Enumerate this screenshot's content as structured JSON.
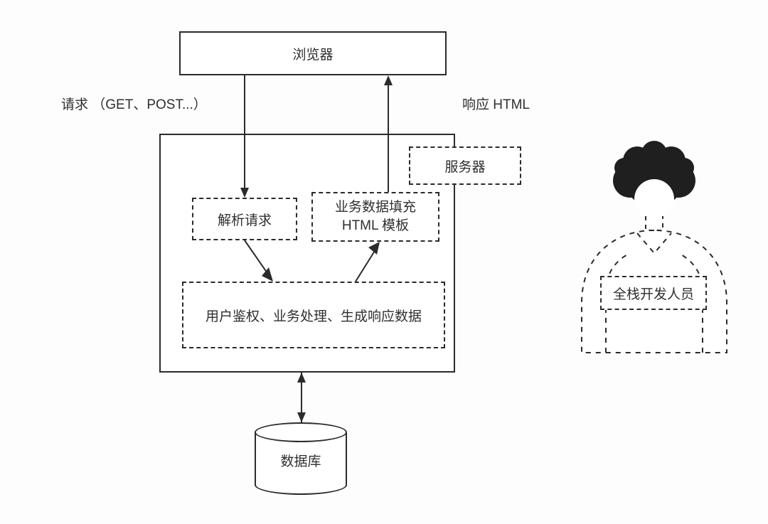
{
  "browser": {
    "label": "浏览器"
  },
  "request_label": "请求 （GET、POST...）",
  "response_label": "响应 HTML",
  "server": {
    "label": "服务器",
    "parse_request": "解析请求",
    "fill_template": "业务数据填充\nHTML 模板",
    "process": "用户鉴权、业务处理、生成响应数据"
  },
  "database": {
    "label": "数据库"
  },
  "person": {
    "role": "全栈开发人员"
  }
}
